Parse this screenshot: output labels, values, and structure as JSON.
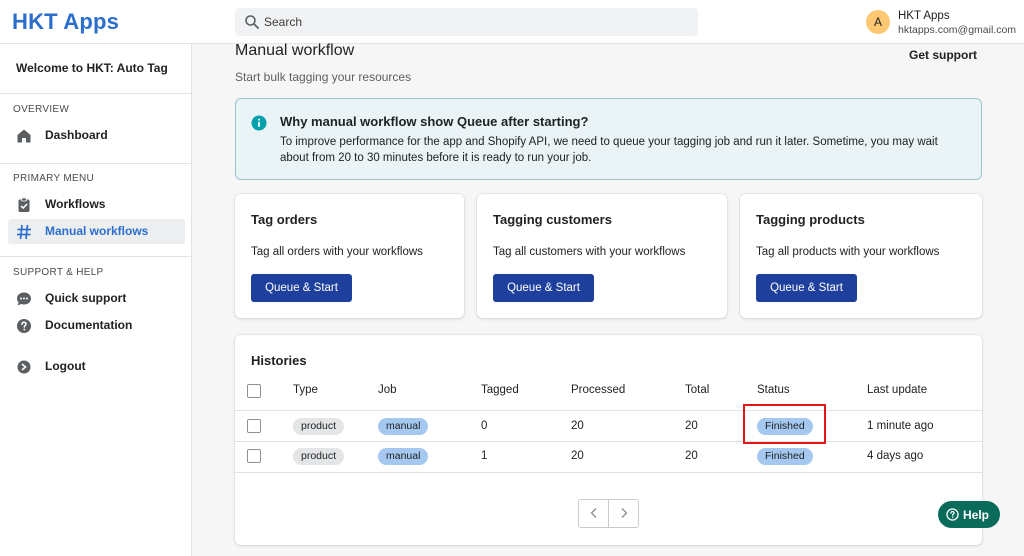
{
  "header": {
    "logo": "HKT Apps",
    "search_placeholder": "Search",
    "user": {
      "initial": "A",
      "name": "HKT Apps",
      "email": "hktapps.com@gmail.com"
    }
  },
  "sidebar": {
    "welcome": "Welcome to HKT: Auto Tag",
    "sections": {
      "overview": "OVERVIEW",
      "primary": "PRIMARY MENU",
      "support": "SUPPORT & HELP"
    },
    "items": [
      {
        "label": "Dashboard",
        "icon": "home-icon"
      },
      {
        "label": "Workflows",
        "icon": "clipboard-icon"
      },
      {
        "label": "Manual workflows",
        "icon": "hash-icon",
        "active": true
      },
      {
        "label": "Quick support",
        "icon": "chat-icon"
      },
      {
        "label": "Documentation",
        "icon": "question-icon"
      },
      {
        "label": "Logout",
        "icon": "logout-icon"
      }
    ]
  },
  "page": {
    "title": "Manual workflow",
    "subtitle": "Start bulk tagging your resources",
    "get_support": "Get support"
  },
  "banner": {
    "title": "Why manual workflow show Queue after starting?",
    "body": "To improve performance for the app and Shopify API, we need to queue your tagging job and run it later. Sometime, you may wait about from 20 to 30 minutes before it is ready to run your job."
  },
  "cards": [
    {
      "title": "Tag orders",
      "desc": "Tag all orders with your workflows",
      "button": "Queue & Start"
    },
    {
      "title": "Tagging customers",
      "desc": "Tag all customers with your workflows",
      "button": "Queue & Start"
    },
    {
      "title": "Tagging products",
      "desc": "Tag all products with your workflows",
      "button": "Queue & Start"
    }
  ],
  "histories": {
    "title": "Histories",
    "columns": [
      "Type",
      "Job",
      "Tagged",
      "Processed",
      "Total",
      "Status",
      "Last update"
    ],
    "rows": [
      {
        "type": "product",
        "job": "manual",
        "tagged": "0",
        "processed": "20",
        "total": "20",
        "status": "Finished",
        "updated": "1 minute ago"
      },
      {
        "type": "product",
        "job": "manual",
        "tagged": "1",
        "processed": "20",
        "total": "20",
        "status": "Finished",
        "updated": "4 days ago"
      }
    ]
  },
  "help": {
    "label": "Help"
  },
  "colors": {
    "accent": "#2c6ecb",
    "primary_button": "#1e3f9b",
    "help_button": "#0b6b5b",
    "highlight": "#e0161b"
  }
}
